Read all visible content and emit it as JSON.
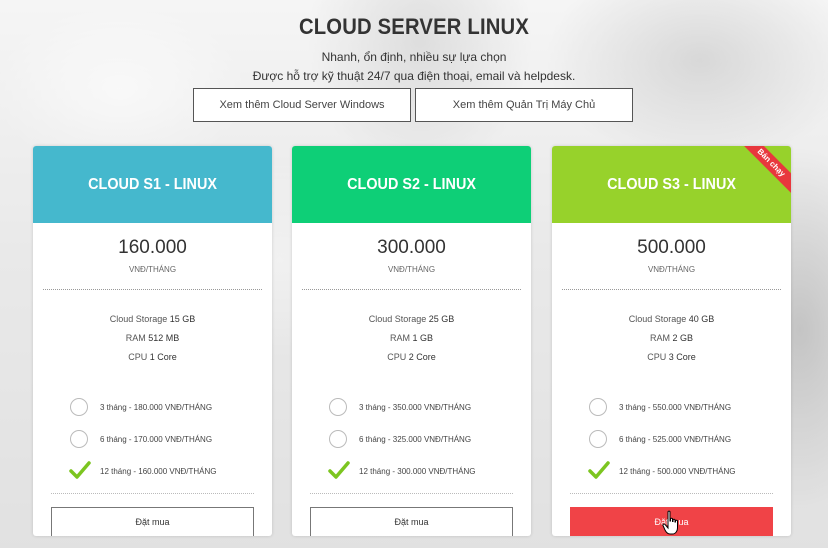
{
  "header": {
    "title": "CLOUD SERVER LINUX",
    "subtitle_line1": "Nhanh, ổn định, nhiều sự lựa chọn",
    "subtitle_line2": "Được hỗ trợ kỹ thuật 24/7 qua điện thoại, email và helpdesk."
  },
  "links": {
    "windows": "Xem thêm Cloud Server Windows",
    "admin": "Xem thêm Quản Trị Máy Chủ"
  },
  "colors": {
    "s1": "#45b8cd",
    "s2": "#0ecf77",
    "s3": "#97d22b",
    "buy_active": "#f04347"
  },
  "plans": [
    {
      "name": "CLOUD S1 - LINUX",
      "price": "160.000",
      "unit": "VNĐ/THÁNG",
      "storage_label": "Cloud Storage",
      "storage": "15 GB",
      "ram_label": "RAM",
      "ram": "512 MB",
      "cpu_label": "CPU",
      "cpu": "1 Core",
      "options": [
        "3 tháng - 180.000 VNĐ/THÁNG",
        "6 tháng - 170.000 VNĐ/THÁNG",
        "12 tháng - 160.000 VNĐ/THÁNG"
      ],
      "selected_option": 2,
      "buy": "Đặt mua"
    },
    {
      "name": "CLOUD S2 - LINUX",
      "price": "300.000",
      "unit": "VNĐ/THÁNG",
      "storage_label": "Cloud Storage",
      "storage": "25 GB",
      "ram_label": "RAM",
      "ram": "1 GB",
      "cpu_label": "CPU",
      "cpu": "2 Core",
      "options": [
        "3 tháng - 350.000 VNĐ/THÁNG",
        "6 tháng - 325.000 VNĐ/THÁNG",
        "12 tháng - 300.000 VNĐ/THÁNG"
      ],
      "selected_option": 2,
      "buy": "Đặt mua"
    },
    {
      "name": "CLOUD S3 - LINUX",
      "ribbon": "Bán chạy",
      "price": "500.000",
      "unit": "VNĐ/THÁNG",
      "storage_label": "Cloud Storage",
      "storage": "40 GB",
      "ram_label": "RAM",
      "ram": "2 GB",
      "cpu_label": "CPU",
      "cpu": "3 Core",
      "options": [
        "3 tháng - 550.000 VNĐ/THÁNG",
        "6 tháng - 525.000 VNĐ/THÁNG",
        "12 tháng - 500.000 VNĐ/THÁNG"
      ],
      "selected_option": 2,
      "buy": "Đặt mua"
    }
  ]
}
